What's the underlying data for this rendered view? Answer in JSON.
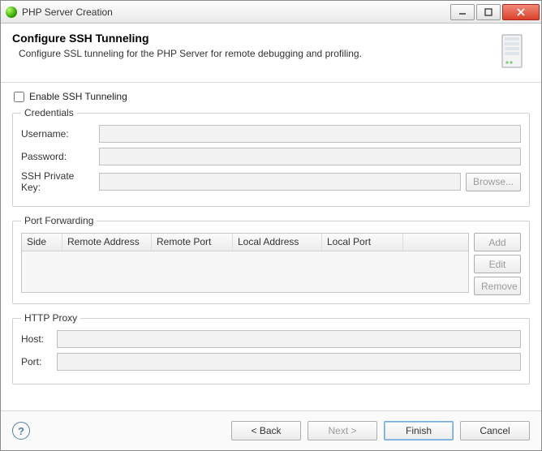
{
  "window": {
    "title": "PHP Server Creation"
  },
  "banner": {
    "heading": "Configure SSH Tunneling",
    "description": "Configure SSL tunneling for the PHP Server for remote debugging and profiling."
  },
  "enable": {
    "label": "Enable SSH Tunneling",
    "checked": false
  },
  "credentials": {
    "legend": "Credentials",
    "username_label": "Username:",
    "password_label": "Password:",
    "sshkey_label": "SSH Private Key:",
    "browse_label": "Browse...",
    "username_value": "",
    "password_value": "",
    "sshkey_value": ""
  },
  "portfwd": {
    "legend": "Port Forwarding",
    "cols": {
      "side": "Side",
      "raddr": "Remote Address",
      "rport": "Remote Port",
      "laddr": "Local Address",
      "lport": "Local Port"
    },
    "add_label": "Add",
    "edit_label": "Edit",
    "remove_label": "Remove"
  },
  "proxy": {
    "legend": "HTTP Proxy",
    "host_label": "Host:",
    "port_label": "Port:",
    "host_value": "",
    "port_value": ""
  },
  "footer": {
    "back_label": "< Back",
    "next_label": "Next >",
    "finish_label": "Finish",
    "cancel_label": "Cancel"
  }
}
